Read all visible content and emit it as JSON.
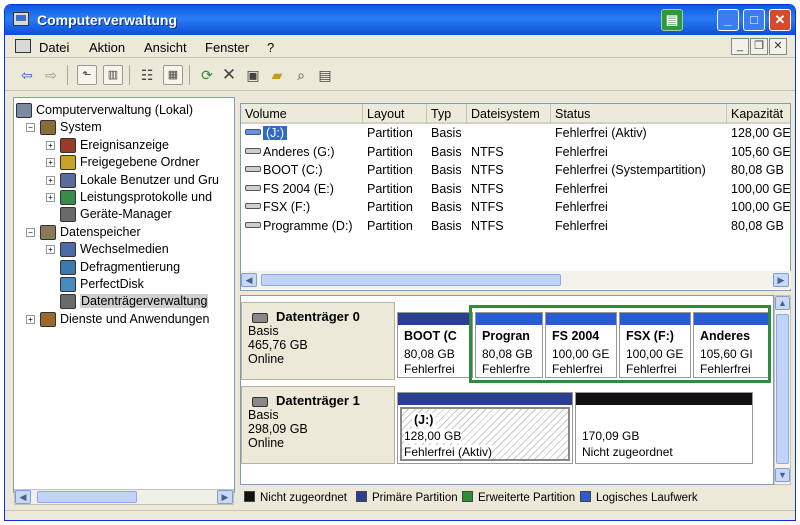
{
  "window": {
    "title": "Computerverwaltung",
    "controls": {
      "minimize": "_",
      "maximize": "□",
      "close": "✕"
    }
  },
  "menu": {
    "items": [
      "Datei",
      "Aktion",
      "Ansicht",
      "Fenster",
      "?"
    ],
    "mdi_controls": {
      "minimize": "_",
      "restore": "❐",
      "close": "✕"
    }
  },
  "toolbar": {
    "icons": [
      "back-arrow-icon",
      "forward-arrow-icon",
      "up-folder-icon",
      "show-hide-tree-icon",
      "properties-icon",
      "details-icon",
      "refresh-icon",
      "delete-icon",
      "disk-properties-icon",
      "open-folder-icon",
      "search-icon",
      "help-icon"
    ]
  },
  "tree": {
    "nodes": [
      {
        "label": "Computerverwaltung (Lokal)",
        "level": 0,
        "expander": "",
        "icon": "computer-icon"
      },
      {
        "label": "System",
        "level": 1,
        "expander": "−",
        "icon": "tools-icon"
      },
      {
        "label": "Ereignisanzeige",
        "level": 2,
        "expander": "+",
        "icon": "event-viewer-icon"
      },
      {
        "label": "Freigegebene Ordner",
        "level": 2,
        "expander": "+",
        "icon": "shared-folder-icon"
      },
      {
        "label": "Lokale Benutzer und Gru",
        "level": 2,
        "expander": "+",
        "icon": "users-icon"
      },
      {
        "label": "Leistungsprotokolle und",
        "level": 2,
        "expander": "+",
        "icon": "performance-icon"
      },
      {
        "label": "Geräte-Manager",
        "level": 2,
        "expander": "",
        "icon": "device-manager-icon"
      },
      {
        "label": "Datenspeicher",
        "level": 1,
        "expander": "−",
        "icon": "storage-icon"
      },
      {
        "label": "Wechselmedien",
        "level": 2,
        "expander": "+",
        "icon": "removable-media-icon"
      },
      {
        "label": "Defragmentierung",
        "level": 2,
        "expander": "",
        "icon": "defrag-icon"
      },
      {
        "label": "PerfectDisk",
        "level": 2,
        "expander": "",
        "icon": "perfectdisk-icon"
      },
      {
        "label": "Datenträgerverwaltung",
        "level": 2,
        "expander": "",
        "icon": "disk-management-icon",
        "selected": true
      },
      {
        "label": "Dienste und Anwendungen",
        "level": 1,
        "expander": "+",
        "icon": "services-icon"
      }
    ]
  },
  "volumes": {
    "columns": [
      "Volume",
      "Layout",
      "Typ",
      "Dateisystem",
      "Status",
      "Kapazität"
    ],
    "rows": [
      {
        "volume": "(J:)",
        "layout": "Partition",
        "typ": "Basis",
        "fs": "",
        "status": "Fehlerfrei (Aktiv)",
        "capacity": "128,00 GE",
        "selected": true
      },
      {
        "volume": "Anderes (G:)",
        "layout": "Partition",
        "typ": "Basis",
        "fs": "NTFS",
        "status": "Fehlerfrei",
        "capacity": "105,60 GE"
      },
      {
        "volume": "BOOT (C:)",
        "layout": "Partition",
        "typ": "Basis",
        "fs": "NTFS",
        "status": "Fehlerfrei (Systempartition)",
        "capacity": "80,08 GB"
      },
      {
        "volume": "FS 2004 (E:)",
        "layout": "Partition",
        "typ": "Basis",
        "fs": "NTFS",
        "status": "Fehlerfrei",
        "capacity": "100,00 GE"
      },
      {
        "volume": "FSX (F:)",
        "layout": "Partition",
        "typ": "Basis",
        "fs": "NTFS",
        "status": "Fehlerfrei",
        "capacity": "100,00 GE"
      },
      {
        "volume": "Programme (D:)",
        "layout": "Partition",
        "typ": "Basis",
        "fs": "NTFS",
        "status": "Fehlerfrei",
        "capacity": "80,08 GB"
      }
    ]
  },
  "disks": [
    {
      "name": "Datenträger 0",
      "type": "Basis",
      "size": "465,76 GB",
      "state": "Online",
      "partitions": [
        {
          "title": "BOOT (C",
          "size": "80,08 GB",
          "status": "Fehlerfrei",
          "bar_color": "#2a3f8f"
        },
        {
          "title": "Progran",
          "size": "80,08 GB",
          "status": "Fehlerfre",
          "bar_color": "#2a5bd0"
        },
        {
          "title": "FS 2004",
          "size": "100,00 GE",
          "status": "Fehlerfrei",
          "bar_color": "#2a5bd0"
        },
        {
          "title": "FSX (F:)",
          "size": "100,00 GE",
          "status": "Fehlerfrei",
          "bar_color": "#2a5bd0"
        },
        {
          "title": "Anderes",
          "size": "105,60 GI",
          "status": "Fehlerfrei",
          "bar_color": "#2a5bd0"
        }
      ]
    },
    {
      "name": "Datenträger 1",
      "type": "Basis",
      "size": "298,09 GB",
      "state": "Online",
      "partitions": [
        {
          "title": "(J:)",
          "size": "128,00 GB",
          "status": "Fehlerfrei (Aktiv)",
          "bar_color": "#2a3f8f"
        },
        {
          "title": "",
          "size": "170,09 GB",
          "status": "Nicht zugeordnet",
          "bar_color": "#111111"
        }
      ]
    }
  ],
  "legend": [
    {
      "label": "Nicht zugeordnet",
      "color": "#111111"
    },
    {
      "label": "Primäre Partition",
      "color": "#2a3f8f"
    },
    {
      "label": "Erweiterte Partition",
      "color": "#2f8d3a"
    },
    {
      "label": "Logisches Laufwerk",
      "color": "#2a5bd0"
    }
  ]
}
